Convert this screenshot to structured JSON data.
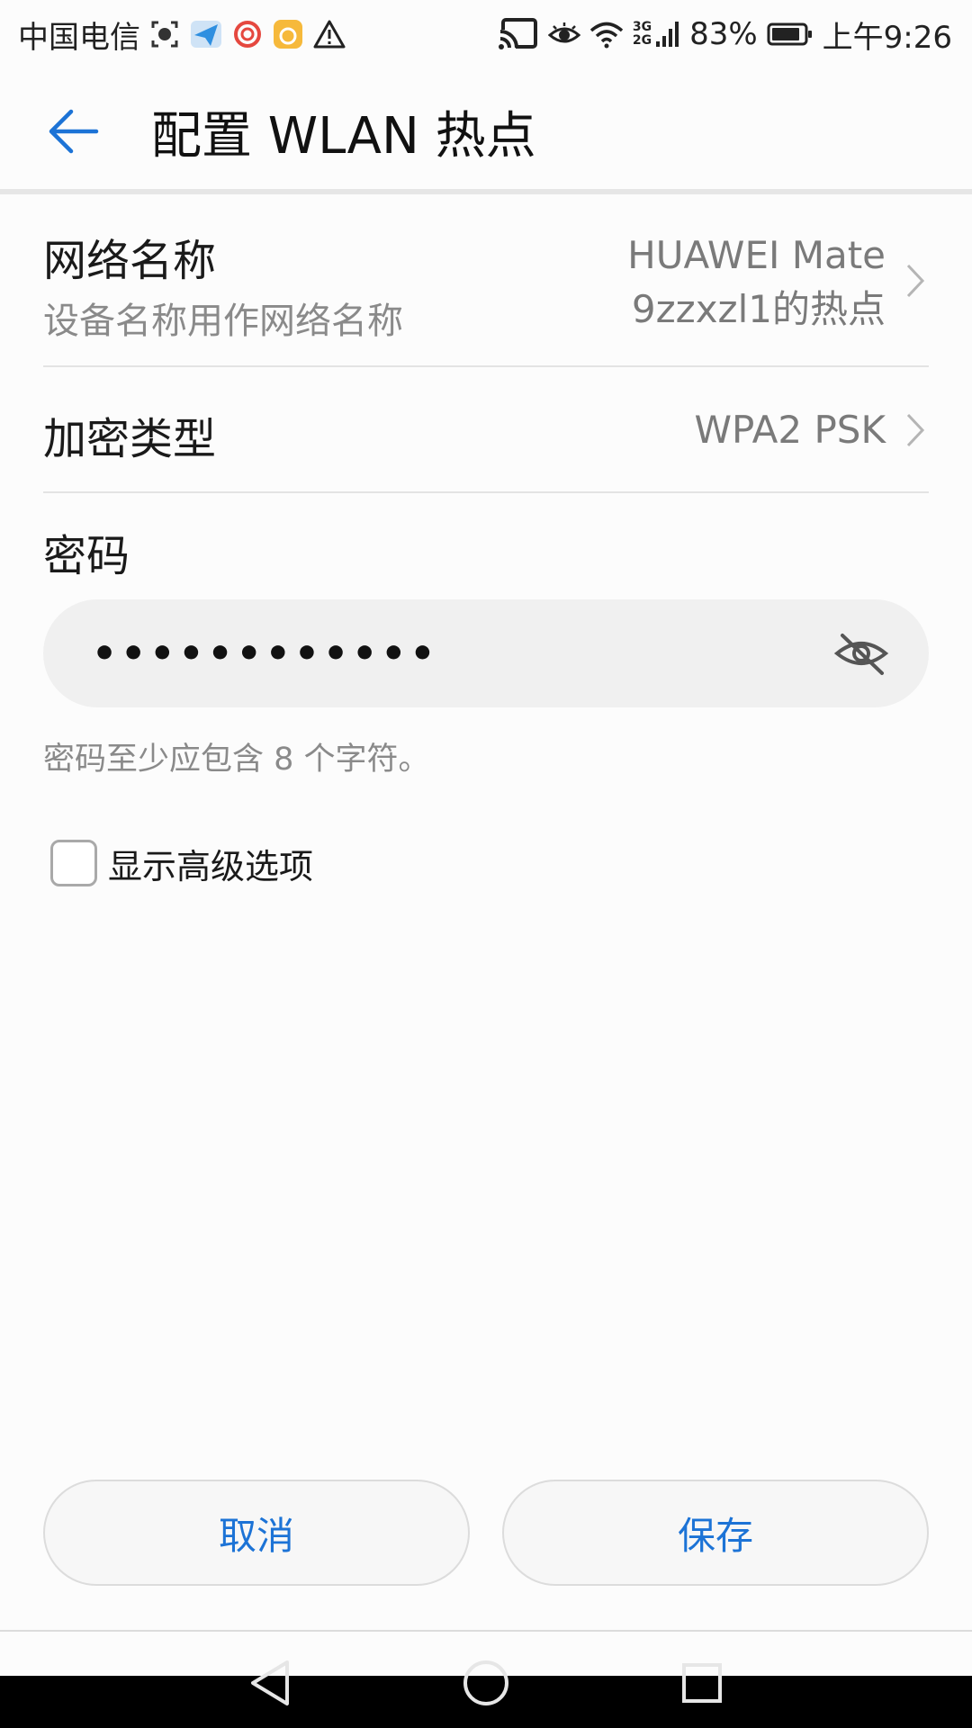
{
  "status_bar": {
    "carrier": "中国电信",
    "network_top": "3G",
    "network_bottom": "2G",
    "battery": "83%",
    "time": "上午9:26",
    "icons": [
      "screenshot-icon",
      "paper-plane-icon",
      "swirl-app-icon",
      "orange-app-icon",
      "warning-icon",
      "cast-icon",
      "eye-icon",
      "wifi-icon",
      "signal-icon",
      "battery-icon"
    ]
  },
  "app_bar": {
    "back_icon": "arrow-left-icon",
    "title": "配置 WLAN 热点"
  },
  "network_name": {
    "title": "网络名称",
    "subtitle": "设备名称用作网络名称",
    "value_line1": "HUAWEI Mate",
    "value_line2": "9zzxzl1的热点"
  },
  "encryption": {
    "title": "加密类型",
    "value": "WPA2 PSK"
  },
  "password": {
    "label": "密码",
    "masked_value": "••••••••••••",
    "hint": "密码至少应包含 8 个字符。",
    "toggle_icon": "eye-off-icon"
  },
  "advanced": {
    "label": "显示高级选项",
    "checked": false
  },
  "buttons": {
    "cancel": "取消",
    "save": "保存"
  },
  "colors": {
    "accent": "#1c73d6",
    "secondary_text": "#8a8a8a",
    "field_bg": "#f0f0f0"
  }
}
